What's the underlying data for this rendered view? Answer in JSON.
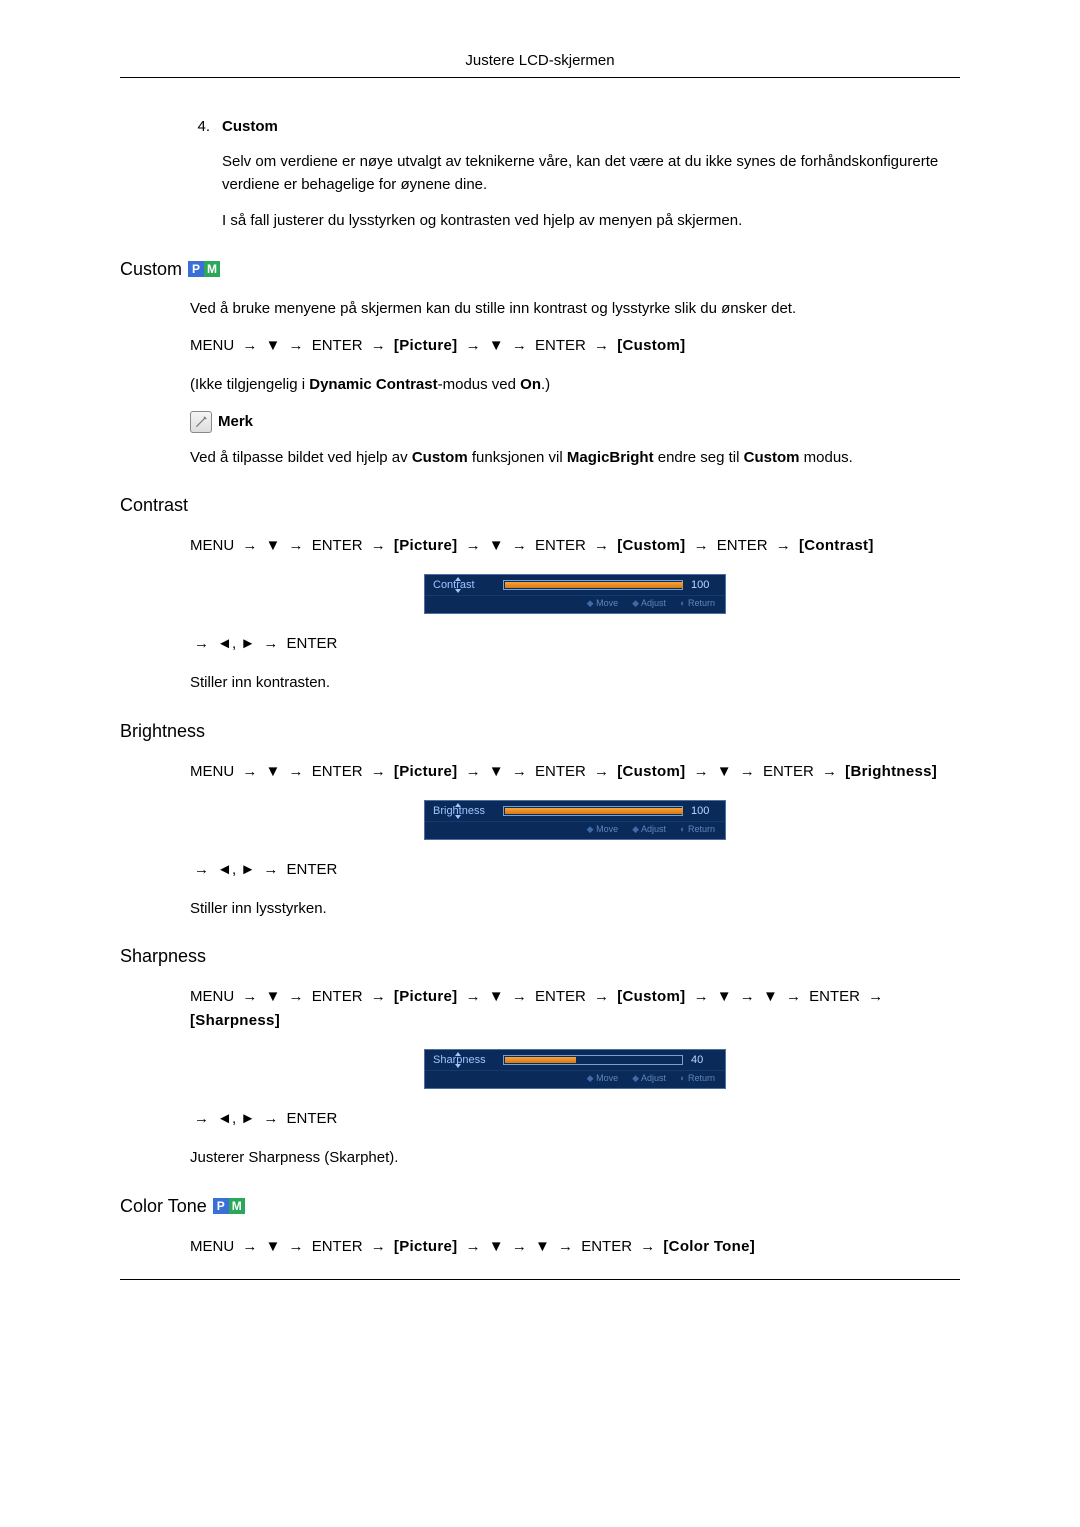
{
  "header": {
    "title": "Justere LCD-skjermen"
  },
  "intro": {
    "num": "4.",
    "title": "Custom",
    "p1": "Selv om verdiene er nøye utvalgt av teknikerne våre, kan det være at du ikke synes de forhåndskonfigurerte verdiene er behagelige for øynene dine.",
    "p2": "I så fall justerer du lysstyrken og kontrasten ved hjelp av menyen på skjermen."
  },
  "custom": {
    "heading": "Custom",
    "p1": "Ved å bruke menyene på skjermen kan du stille inn kontrast og lysstyrke slik du ønsker det.",
    "path": [
      "MENU",
      "→",
      "▼",
      "→",
      "ENTER",
      "→",
      "[Picture]",
      "→",
      "▼",
      "→",
      "ENTER",
      "→",
      "[Custom]"
    ],
    "unavail_pre": "(Ikke tilgjengelig i ",
    "unavail_b1": "Dynamic Contrast",
    "unavail_mid": "-modus ved ",
    "unavail_b2": "On",
    "unavail_post": ".)",
    "note_label": "Merk",
    "p2_pre": "Ved å tilpasse bildet ved hjelp av ",
    "p2_b1": "Custom",
    "p2_mid": " funksjonen vil ",
    "p2_b2": "MagicBright",
    "p2_mid2": " endre seg til ",
    "p2_b3": "Custom",
    "p2_post": " modus."
  },
  "contrast": {
    "heading": "Contrast",
    "path": [
      "MENU",
      "→",
      "▼",
      "→",
      "ENTER",
      "→",
      "[Picture]",
      "→",
      "▼",
      "→",
      "ENTER",
      "→",
      "[Custom]",
      "→",
      "ENTER",
      "→",
      "[Contrast]"
    ],
    "osd": {
      "name": "Contrast",
      "value": "100",
      "fill": 100,
      "move": "Move",
      "adjust": "Adjust",
      "ret": "Return"
    },
    "path2": [
      "→",
      "◄, ►",
      "→",
      "ENTER"
    ],
    "desc": "Stiller inn kontrasten."
  },
  "brightness": {
    "heading": "Brightness",
    "path": [
      "MENU",
      "→",
      "▼",
      "→",
      "ENTER",
      "→",
      "[Picture]",
      "→",
      "▼",
      "→",
      "ENTER",
      "→",
      "[Custom]",
      "→",
      "▼",
      "→",
      "ENTER",
      "→",
      "[Brightness]"
    ],
    "osd": {
      "name": "Brightness",
      "value": "100",
      "fill": 100,
      "move": "Move",
      "adjust": "Adjust",
      "ret": "Return"
    },
    "path2": [
      "→",
      "◄, ►",
      "→",
      "ENTER"
    ],
    "desc": "Stiller inn lysstyrken."
  },
  "sharpness": {
    "heading": "Sharpness",
    "path": [
      "MENU",
      "→",
      "▼",
      "→",
      "ENTER",
      "→",
      "[Picture]",
      "→",
      "▼",
      "→",
      "ENTER",
      "→",
      "[Custom]",
      "→",
      "▼",
      "→",
      "▼",
      "→",
      "ENTER",
      "→",
      "[Sharpness]"
    ],
    "osd": {
      "name": "Sharpness",
      "value": "40",
      "fill": 40,
      "move": "Move",
      "adjust": "Adjust",
      "ret": "Return"
    },
    "path2": [
      "→",
      "◄, ►",
      "→",
      "ENTER"
    ],
    "desc": "Justerer Sharpness (Skarphet)."
  },
  "colortone": {
    "heading": "Color Tone",
    "path": [
      "MENU",
      "→",
      "▼",
      "→",
      "ENTER",
      "→",
      "[Picture]",
      "→",
      "▼",
      "→",
      "▼",
      "→",
      "ENTER",
      "→",
      "[Color Tone]"
    ]
  },
  "badge": {
    "p": "P",
    "m": "M"
  }
}
